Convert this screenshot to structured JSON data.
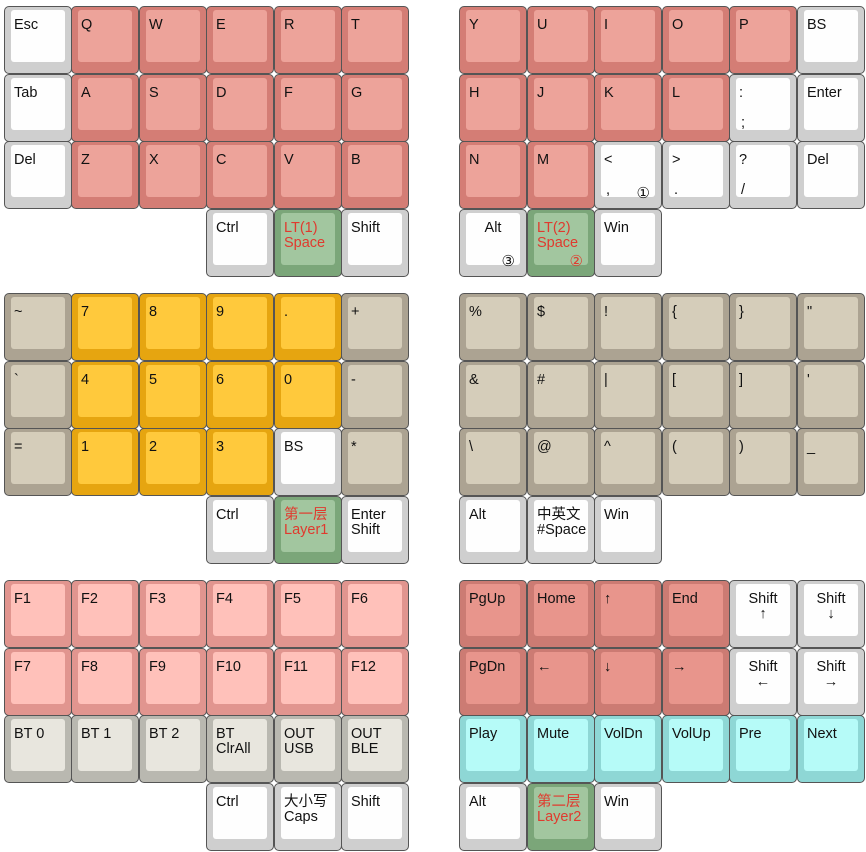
{
  "layers": [
    {
      "name": "layer-0",
      "keys": [
        {
          "label": "Esc",
          "color": "white"
        },
        {
          "label": "Q",
          "color": "red"
        },
        {
          "label": "W",
          "color": "red"
        },
        {
          "label": "E",
          "color": "red"
        },
        {
          "label": "R",
          "color": "red"
        },
        {
          "label": "T",
          "color": "red"
        },
        {
          "label": "Y",
          "color": "red"
        },
        {
          "label": "U",
          "color": "red"
        },
        {
          "label": "I",
          "color": "red"
        },
        {
          "label": "O",
          "color": "red"
        },
        {
          "label": "P",
          "color": "red"
        },
        {
          "label": "BS",
          "color": "white"
        },
        {
          "label": "Tab",
          "color": "white"
        },
        {
          "label": "A",
          "color": "red"
        },
        {
          "label": "S",
          "color": "red"
        },
        {
          "label": "D",
          "color": "red"
        },
        {
          "label": "F",
          "color": "red"
        },
        {
          "label": "G",
          "color": "red"
        },
        {
          "label": "H",
          "color": "red"
        },
        {
          "label": "J",
          "color": "red"
        },
        {
          "label": "K",
          "color": "red"
        },
        {
          "label": "L",
          "color": "red"
        },
        {
          "label": ":",
          "label2": ";",
          "color": "white"
        },
        {
          "label": "Enter",
          "color": "white"
        },
        {
          "label": "Del",
          "color": "white"
        },
        {
          "label": "Z",
          "color": "red"
        },
        {
          "label": "X",
          "color": "red"
        },
        {
          "label": "C",
          "color": "red"
        },
        {
          "label": "V",
          "color": "red"
        },
        {
          "label": "B",
          "color": "red"
        },
        {
          "label": "N",
          "color": "red"
        },
        {
          "label": "M",
          "color": "red"
        },
        {
          "label": "<",
          "label2": ",",
          "mark": "①",
          "color": "white"
        },
        {
          "label": ">",
          "label2": ".",
          "color": "white"
        },
        {
          "label": "?",
          "label2": "/",
          "color": "white"
        },
        {
          "label": "Del",
          "color": "white"
        },
        {
          "label": "Ctrl",
          "color": "white"
        },
        {
          "label": "LT(1)\nSpace",
          "color": "green",
          "red": true
        },
        {
          "label": "Shift",
          "color": "white"
        },
        {
          "label": "Alt",
          "color": "white",
          "center": true,
          "mark": "③"
        },
        {
          "label": "LT(2)\nSpace",
          "color": "green",
          "red": true,
          "mark": "②",
          "mark_red": true
        },
        {
          "label": "Win",
          "color": "white"
        }
      ]
    },
    {
      "name": "layer-1",
      "keys": [
        {
          "label": "~",
          "color": "gray"
        },
        {
          "label": "7",
          "color": "yellow"
        },
        {
          "label": "8",
          "color": "yellow"
        },
        {
          "label": "9",
          "color": "yellow"
        },
        {
          "label": ".",
          "color": "yellow"
        },
        {
          "label": "+",
          "color": "gray"
        },
        {
          "label": "%",
          "color": "gray"
        },
        {
          "label": "$",
          "color": "gray"
        },
        {
          "label": "!",
          "color": "gray"
        },
        {
          "label": "{",
          "color": "gray"
        },
        {
          "label": "}",
          "color": "gray"
        },
        {
          "label": "\"",
          "color": "gray"
        },
        {
          "label": "`",
          "color": "gray"
        },
        {
          "label": "4",
          "color": "yellow"
        },
        {
          "label": "5",
          "color": "yellow"
        },
        {
          "label": "6",
          "color": "yellow"
        },
        {
          "label": "0",
          "color": "yellow"
        },
        {
          "label": "-",
          "color": "gray"
        },
        {
          "label": "&",
          "color": "gray"
        },
        {
          "label": "#",
          "color": "gray"
        },
        {
          "label": "|",
          "color": "gray"
        },
        {
          "label": "[",
          "color": "gray"
        },
        {
          "label": "]",
          "color": "gray"
        },
        {
          "label": "'",
          "color": "gray"
        },
        {
          "label": "=",
          "color": "gray"
        },
        {
          "label": "1",
          "color": "yellow"
        },
        {
          "label": "2",
          "color": "yellow"
        },
        {
          "label": "3",
          "color": "yellow"
        },
        {
          "label": "BS",
          "color": "white"
        },
        {
          "label": "*",
          "color": "gray"
        },
        {
          "label": "\\",
          "color": "gray"
        },
        {
          "label": "@",
          "color": "gray"
        },
        {
          "label": "^",
          "color": "gray"
        },
        {
          "label": "(",
          "color": "gray"
        },
        {
          "label": ")",
          "color": "gray"
        },
        {
          "label": "_",
          "color": "gray"
        },
        {
          "label": "Ctrl",
          "color": "white"
        },
        {
          "label": "第一层\nLayer1",
          "color": "green",
          "red": true
        },
        {
          "label": "Enter\nShift",
          "color": "white"
        },
        {
          "label": "Alt",
          "color": "white"
        },
        {
          "label": "中英文\n#Space",
          "color": "white"
        },
        {
          "label": "Win",
          "color": "white"
        }
      ]
    },
    {
      "name": "layer-2",
      "keys": [
        {
          "label": "F1",
          "color": "pink"
        },
        {
          "label": "F2",
          "color": "pink"
        },
        {
          "label": "F3",
          "color": "pink"
        },
        {
          "label": "F4",
          "color": "pink"
        },
        {
          "label": "F5",
          "color": "pink"
        },
        {
          "label": "F6",
          "color": "pink"
        },
        {
          "label": "PgUp",
          "color": "darkred"
        },
        {
          "label": "Home",
          "color": "darkred"
        },
        {
          "label": "↑",
          "color": "darkred"
        },
        {
          "label": "End",
          "color": "darkred"
        },
        {
          "label": "Shift\n↑",
          "color": "white",
          "center": true
        },
        {
          "label": "Shift\n↓",
          "color": "white",
          "center": true
        },
        {
          "label": "F7",
          "color": "pink"
        },
        {
          "label": "F8",
          "color": "pink"
        },
        {
          "label": "F9",
          "color": "pink"
        },
        {
          "label": "F10",
          "color": "pink"
        },
        {
          "label": "F11",
          "color": "pink"
        },
        {
          "label": "F12",
          "color": "pink"
        },
        {
          "label": "PgDn",
          "color": "darkred"
        },
        {
          "label": "←",
          "color": "darkred"
        },
        {
          "label": "↓",
          "color": "darkred"
        },
        {
          "label": "→",
          "color": "darkred"
        },
        {
          "label": "Shift\n←",
          "color": "white",
          "center": true
        },
        {
          "label": "Shift\n→",
          "color": "white",
          "center": true
        },
        {
          "label": "BT 0",
          "color": "light"
        },
        {
          "label": "BT 1",
          "color": "light"
        },
        {
          "label": "BT 2",
          "color": "light"
        },
        {
          "label": "BT\nClrAll",
          "color": "light"
        },
        {
          "label": "OUT\nUSB",
          "color": "light"
        },
        {
          "label": "OUT\nBLE",
          "color": "light"
        },
        {
          "label": "Play",
          "color": "cyan"
        },
        {
          "label": "Mute",
          "color": "cyan"
        },
        {
          "label": "VolDn",
          "color": "cyan"
        },
        {
          "label": "VolUp",
          "color": "cyan"
        },
        {
          "label": "Pre",
          "color": "cyan"
        },
        {
          "label": "Next",
          "color": "cyan"
        },
        {
          "label": "Ctrl",
          "color": "white"
        },
        {
          "label": "大小写\nCaps",
          "color": "white"
        },
        {
          "label": "Shift",
          "color": "white"
        },
        {
          "label": "Alt",
          "color": "white"
        },
        {
          "label": "第二层\nLayer2",
          "color": "green",
          "red": true
        },
        {
          "label": "Win",
          "color": "white"
        }
      ]
    }
  ]
}
